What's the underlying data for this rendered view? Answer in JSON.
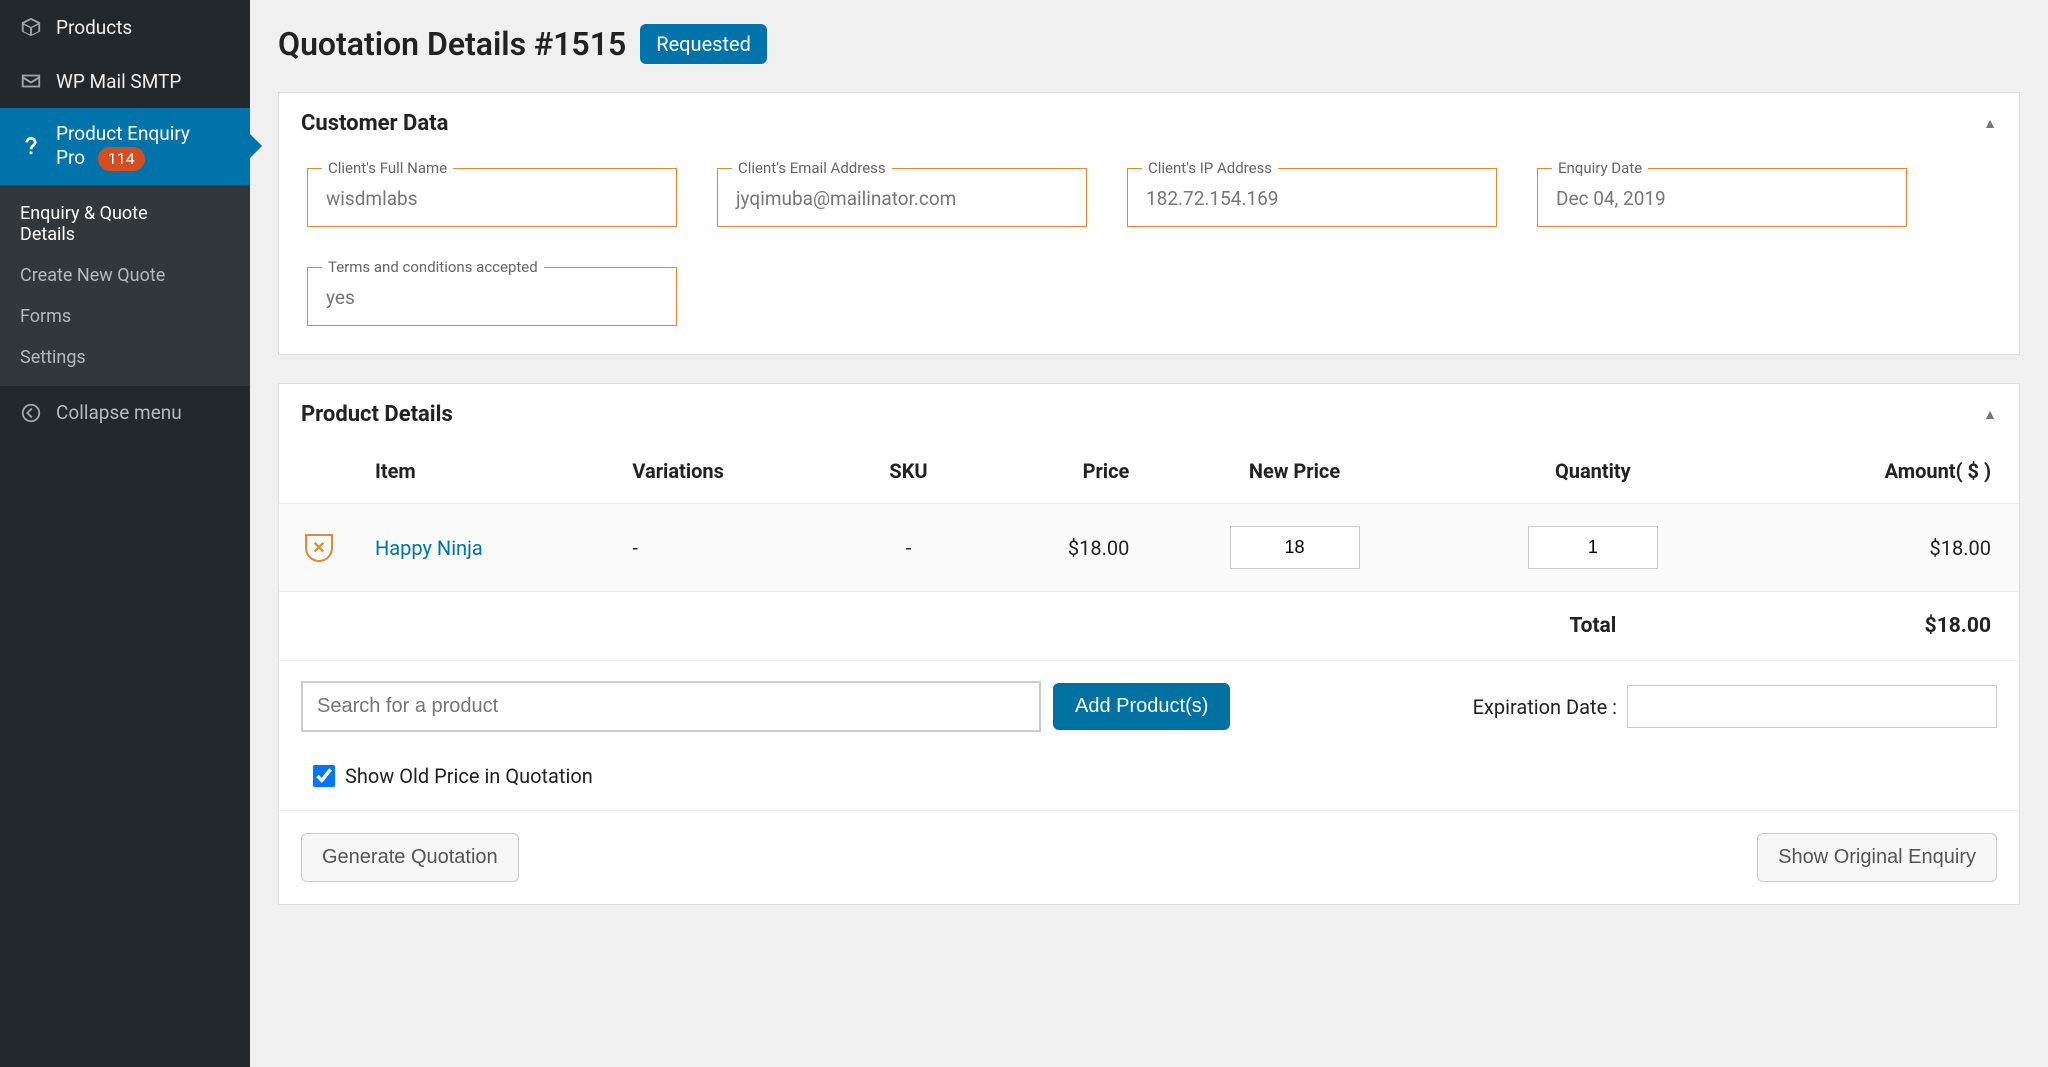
{
  "sidebar": {
    "products": "Products",
    "wpmailsmtp": "WP Mail SMTP",
    "pep": {
      "line1": "Product Enquiry",
      "line2": "Pro",
      "badge": "114"
    },
    "submenu": {
      "enquiry1": "Enquiry & Quote",
      "enquiry2": "Details",
      "create": "Create New Quote",
      "forms": "Forms",
      "settings": "Settings"
    },
    "collapse": "Collapse menu"
  },
  "header": {
    "title": "Quotation Details #1515",
    "status": "Requested"
  },
  "customer": {
    "section_title": "Customer Data",
    "fields": {
      "name": {
        "label": "Client's Full Name",
        "value": "wisdmlabs"
      },
      "email": {
        "label": "Client's Email Address",
        "value": "jyqimuba@mailinator.com"
      },
      "ip": {
        "label": "Client's IP Address",
        "value": "182.72.154.169"
      },
      "date": {
        "label": "Enquiry Date",
        "value": "Dec 04, 2019"
      },
      "terms": {
        "label": "Terms and conditions accepted",
        "value": "yes"
      }
    }
  },
  "products": {
    "section_title": "Product Details",
    "columns": {
      "item": "Item",
      "variations": "Variations",
      "sku": "SKU",
      "price": "Price",
      "newprice": "New Price",
      "quantity": "Quantity",
      "amount": "Amount( $ )"
    },
    "rows": [
      {
        "item": "Happy Ninja",
        "variations": "-",
        "sku": "-",
        "price": "$18.00",
        "new_price": "18",
        "quantity": "1",
        "amount": "$18.00"
      }
    ],
    "total_label": "Total",
    "total_value": "$18.00",
    "search_placeholder": "Search for a product",
    "add_button": "Add Product(s)",
    "expiry_label": "Expiration Date :",
    "show_old_price": "Show Old Price in Quotation",
    "generate_btn": "Generate Quotation",
    "show_original_btn": "Show Original Enquiry"
  }
}
